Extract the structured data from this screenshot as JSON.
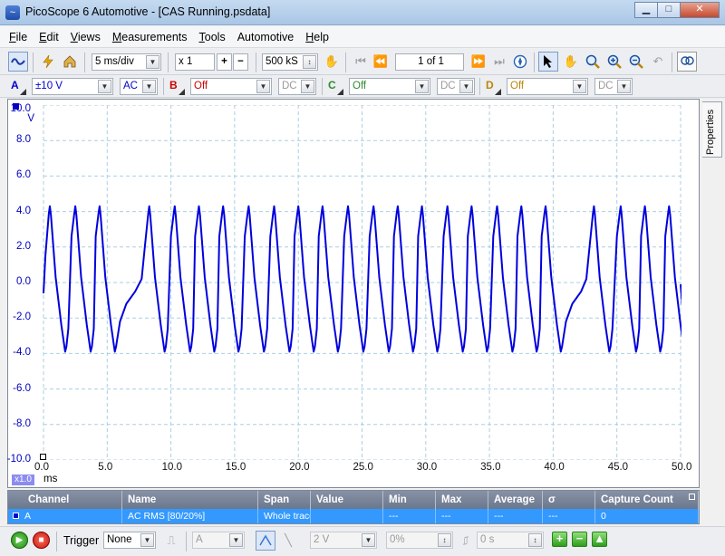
{
  "window": {
    "title": "PicoScope 6 Automotive - [CAS Running.psdata]"
  },
  "menu": [
    {
      "label": "File",
      "key": "F",
      "rest": "ile"
    },
    {
      "label": "Edit",
      "key": "E",
      "rest": "dit"
    },
    {
      "label": "Views",
      "key": "V",
      "rest": "iews"
    },
    {
      "label": "Measurements",
      "key": "M",
      "rest": "easurements"
    },
    {
      "label": "Tools",
      "key": "T",
      "rest": "ools"
    },
    {
      "label": "Automotive",
      "key": "",
      "rest": "Automotive"
    },
    {
      "label": "Help",
      "key": "H",
      "rest": "elp"
    }
  ],
  "toolbar": {
    "timebase": "5 ms/div",
    "zoom": "x 1",
    "samples": "500 kS",
    "page_counter": "1 of 1"
  },
  "channels": [
    {
      "letter": "A",
      "color": "#0000cc",
      "range": "±10 V",
      "coupling": "AC"
    },
    {
      "letter": "B",
      "color": "#cc0000",
      "range": "Off",
      "coupling": "DC"
    },
    {
      "letter": "C",
      "color": "#2e8b2e",
      "range": "Off",
      "coupling": "DC"
    },
    {
      "letter": "D",
      "color": "#b8860b",
      "range": "Off",
      "coupling": "DC"
    }
  ],
  "scope": {
    "y_ticks": [
      "10.0",
      "8.0",
      "6.0",
      "4.0",
      "2.0",
      "0.0",
      "-2.0",
      "-4.0",
      "-6.0",
      "-8.0",
      "-10.0"
    ],
    "y_unit": "V",
    "x_ticks": [
      "0.0",
      "5.0",
      "10.0",
      "15.0",
      "20.0",
      "25.0",
      "30.0",
      "35.0",
      "40.0",
      "45.0",
      "50.0"
    ],
    "x_unit": "ms",
    "zoom_badge": "x1.0",
    "trace_color": "#0000dd"
  },
  "properties_tab": "Properties",
  "measurements": {
    "headers": [
      "Channel",
      "Name",
      "Span",
      "Value",
      "Min",
      "Max",
      "Average",
      "σ",
      "Capture Count"
    ],
    "rows": [
      [
        "A",
        "AC RMS [80/20%]",
        "Whole trace",
        "",
        "---",
        "---",
        "---",
        "---",
        "0"
      ]
    ]
  },
  "bottom": {
    "trigger_label": "Trigger",
    "trigger_mode": "None",
    "trigger_channel": "A",
    "threshold": "2 V",
    "pretrigger": "0%",
    "delay": "0 s"
  },
  "chart_data": {
    "type": "line",
    "x_unit": "ms",
    "y_unit": "V",
    "xlim": [
      0,
      50
    ],
    "ylim": [
      -10,
      10
    ],
    "series": [
      {
        "peaks_x": [
          0.5,
          2.5,
          4.4,
          8.3,
          10.3,
          12.2,
          14.1,
          16.1,
          18.1,
          20.0,
          21.9,
          23.9,
          25.9,
          27.8,
          29.7,
          31.7,
          33.6,
          35.6,
          37.5,
          39.4,
          43.2,
          45.3,
          47.2,
          49.1
        ],
        "peak_y": 4.3,
        "trough_y": -3.9,
        "gap_after_x": [
          4.4,
          39.4
        ]
      }
    ]
  }
}
